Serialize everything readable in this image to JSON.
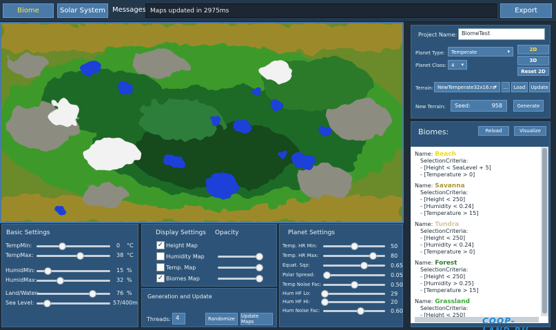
{
  "topbar": {
    "biome_tab": "Biome",
    "solar_tab": "Solar System",
    "messages_label": "Messages:",
    "message": "Maps updated in 2975ms",
    "export": "Export"
  },
  "basic": {
    "title": "Basic Settings",
    "rows": [
      {
        "label": "TempMin:",
        "value": "0",
        "unit": "°C",
        "pos": 0.35
      },
      {
        "label": "TempMax:",
        "value": "38",
        "unit": "°C",
        "pos": 0.59
      },
      {
        "label": "HumidMin:",
        "value": "15",
        "unit": "%",
        "pos": 0.15
      },
      {
        "label": "HumidMax:",
        "value": "32",
        "unit": "%",
        "pos": 0.32
      },
      {
        "label": "Land/Water:",
        "value": "76",
        "unit": "%",
        "pos": 0.76
      },
      {
        "label": "Sea Level:",
        "value": "57/400m",
        "unit": "",
        "pos": 0.14
      }
    ]
  },
  "display": {
    "title": "Display Settings",
    "opacity_label": "Opacity",
    "items": [
      {
        "label": "Height Map",
        "checked": true,
        "opacity": null
      },
      {
        "label": "Humidity Map",
        "checked": false,
        "opacity": 1.0
      },
      {
        "label": "Temp. Map",
        "checked": false,
        "opacity": 1.0
      },
      {
        "label": "Biomes Map",
        "checked": true,
        "opacity": 1.0
      }
    ],
    "generation_title": "Generation and Update",
    "threads_label": "Threads:",
    "threads_value": "4",
    "randomize": "Randomize",
    "update_maps": "Update Maps"
  },
  "planet": {
    "title": "Planet Settings",
    "rows": [
      {
        "label": "Temp. HR Min:",
        "value": "50",
        "pos": 0.5
      },
      {
        "label": "Temp. HR Max:",
        "value": "80",
        "pos": 0.8
      },
      {
        "label": "Equat. Sqz:",
        "value": "0.65",
        "pos": 0.65
      },
      {
        "label": "Polar Spread:",
        "value": "0.05",
        "pos": 0.05
      },
      {
        "label": "Temp Noise Fac:",
        "value": "0.50",
        "pos": 0.5
      },
      {
        "label": "Hum HF Lo:",
        "value": "29",
        "pos": 0.02
      },
      {
        "label": "Hum HF Hi:",
        "value": "20",
        "pos": 0.02
      },
      {
        "label": "Hum Noise Fac:",
        "value": "0.60",
        "pos": 0.6
      }
    ]
  },
  "project": {
    "name_label": "Project Name:",
    "name_value": "BiomeTest",
    "type_label": "Planet Type:",
    "type_value": "Temperate",
    "class_label": "Planet Class:",
    "class_value": "4",
    "btn_2d": "2D",
    "btn_3d": "3D",
    "btn_reset": "Reset 2D",
    "terrain_label": "Terrain:",
    "terrain_value": "NewTemperate32x16.ra",
    "browse": "...",
    "load": "Load",
    "update": "Update",
    "new_terrain_label": "New Terrain:",
    "seed_label": "Seed:",
    "seed_value": "958",
    "generate": "Generate"
  },
  "biomes": {
    "title": "Biomes:",
    "reload": "Reload",
    "visualize": "Visualize",
    "name_prefix": "Name:",
    "criteria_label": "SelectionCriteria:",
    "entries": [
      {
        "name": "Beach",
        "color": "#f0d820",
        "criteria": [
          "- [Height < SeaLevel + 5]",
          "- [Temperature > 0]"
        ]
      },
      {
        "name": "Savanna",
        "color": "#a89a30",
        "criteria": [
          "- [Height < 250]",
          "- [Humidity < 0.24]",
          "- [Temperature > 15]"
        ]
      },
      {
        "name": "Tundra",
        "color": "#d0c8a0",
        "criteria": [
          "- [Height < 250]",
          "- [Humidity < 0.24]",
          "- [Temperature > 0]"
        ]
      },
      {
        "name": "Forest",
        "color": "#2e7a2e",
        "criteria": [
          "- [Height < 250]",
          "- [Humidity > 0.25]",
          "- [Temperature > 15]"
        ]
      },
      {
        "name": "Grassland",
        "color": "#3aa83a",
        "criteria": [
          "- [Height < 250]"
        ]
      }
    ]
  },
  "colors": {
    "accent": "#4a7aa8",
    "panel": "#2d5478",
    "active_tab_text": "#ffe14a",
    "highlight": "#ffe14a"
  },
  "watermark": "COOP-LAND.RU"
}
